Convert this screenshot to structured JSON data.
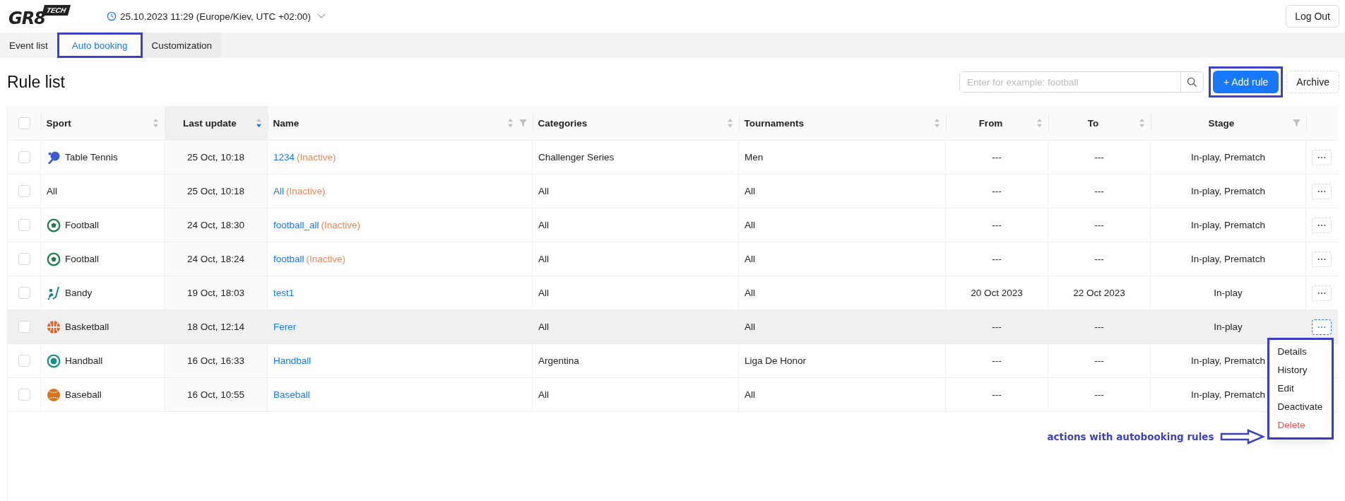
{
  "header": {
    "logo": {
      "main": "GR8",
      "badge": "TECH"
    },
    "datetime": "25.10.2023 11:29 (Europe/Kiev, UTC +02:00)",
    "logout": "Log Out"
  },
  "tabs": [
    {
      "label": "Event list",
      "selected": false,
      "highlighted": false
    },
    {
      "label": "Auto booking",
      "selected": true,
      "highlighted": true
    },
    {
      "label": "Customization",
      "selected": false,
      "highlighted": false
    }
  ],
  "page_title": "Rule list",
  "search": {
    "placeholder": "Enter for example: football"
  },
  "add_button": {
    "label": "+ Add rule",
    "highlighted": true
  },
  "archive_button": "Archive",
  "table": {
    "header_checked": false,
    "columns": [
      {
        "label": "Sport",
        "centered": false,
        "sortable": true,
        "sorted": false,
        "filter": false
      },
      {
        "label": "Last update",
        "centered": true,
        "sortable": true,
        "sorted": true,
        "filter": false
      },
      {
        "label": "Name",
        "centered": false,
        "sortable": true,
        "sorted": false,
        "filter": true
      },
      {
        "label": "Categories",
        "centered": false,
        "sortable": true,
        "sorted": false,
        "filter": false
      },
      {
        "label": "Tournaments",
        "centered": false,
        "sortable": true,
        "sorted": false,
        "filter": false
      },
      {
        "label": "From",
        "centered": true,
        "sortable": true,
        "sorted": false,
        "filter": false
      },
      {
        "label": "To",
        "centered": true,
        "sortable": true,
        "sorted": false,
        "filter": false
      },
      {
        "label": "Stage",
        "centered": true,
        "sortable": false,
        "sorted": false,
        "filter": true
      }
    ],
    "rows": [
      {
        "checked": false,
        "hovered": false,
        "menu_open": false,
        "sport": "Table Tennis",
        "kind": "table-tennis",
        "last_update": "25 Oct, 10:18",
        "name": "1234",
        "status": "(Inactive)",
        "categories": "Challenger Series",
        "tournaments": "Men",
        "from": "---",
        "to": "---",
        "stage": "In-play, Prematch"
      },
      {
        "checked": false,
        "hovered": false,
        "menu_open": false,
        "sport": "All",
        "last_update": "25 Oct, 10:18",
        "name": "All",
        "status": "(Inactive)",
        "categories": "All",
        "tournaments": "All",
        "from": "---",
        "to": "---",
        "stage": "In-play, Prematch"
      },
      {
        "checked": false,
        "hovered": false,
        "menu_open": false,
        "sport": "Football",
        "kind": "football",
        "last_update": "24 Oct, 18:30",
        "name": "football_all",
        "status": "(Inactive)",
        "categories": "All",
        "tournaments": "All",
        "from": "---",
        "to": "---",
        "stage": "In-play, Prematch"
      },
      {
        "checked": false,
        "hovered": false,
        "menu_open": false,
        "sport": "Football",
        "kind": "football",
        "last_update": "24 Oct, 18:24",
        "name": "football",
        "status": "(Inactive)",
        "categories": "All",
        "tournaments": "All",
        "from": "---",
        "to": "---",
        "stage": "In-play, Prematch"
      },
      {
        "checked": false,
        "hovered": false,
        "menu_open": false,
        "sport": "Bandy",
        "kind": "bandy",
        "last_update": "19 Oct, 18:03",
        "name": "test1",
        "categories": "All",
        "tournaments": "All",
        "from": "20 Oct 2023",
        "to": "22 Oct 2023",
        "stage": "In-play"
      },
      {
        "checked": false,
        "hovered": true,
        "menu_open": true,
        "sport": "Basketball",
        "kind": "basketball",
        "last_update": "18 Oct, 12:14",
        "name": "Ferer",
        "categories": "All",
        "tournaments": "All",
        "from": "---",
        "to": "---",
        "stage": "In-play"
      },
      {
        "checked": false,
        "hovered": false,
        "sport": "Handball",
        "kind": "handball",
        "last_update": "16 Oct, 16:33",
        "name": "Handball",
        "categories": "Argentina",
        "tournaments": "Liga De Honor",
        "from": "---",
        "to": "---",
        "stage": "In-play, Prematch"
      },
      {
        "checked": false,
        "hovered": false,
        "sport": "Baseball",
        "kind": "baseball",
        "last_update": "16 Oct, 10:55",
        "name": "Baseball",
        "categories": "All",
        "tournaments": "All",
        "from": "---",
        "to": "---",
        "stage": "In-play, Prematch"
      }
    ]
  },
  "actions_menu": {
    "highlighted": true,
    "items": [
      {
        "label": "Details",
        "kind": "normal"
      },
      {
        "label": "History",
        "kind": "normal"
      },
      {
        "label": "Edit",
        "kind": "normal"
      },
      {
        "label": "Deactivate",
        "kind": "normal"
      },
      {
        "label": "Delete",
        "kind": "danger"
      }
    ]
  },
  "annotation": {
    "text": "actions with autobooking rules"
  }
}
